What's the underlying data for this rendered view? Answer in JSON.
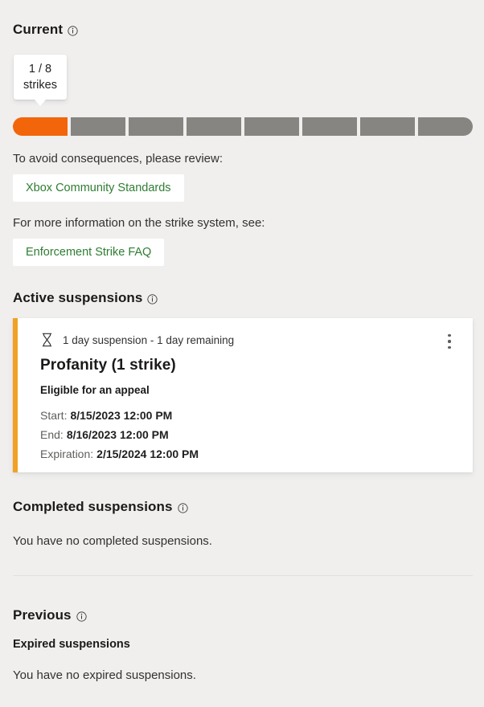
{
  "current": {
    "heading": "Current",
    "info_icon": "info-icon",
    "callout": {
      "count_line": "1 / 8",
      "unit_line": "strikes"
    },
    "meter": {
      "total_segments": 8,
      "filled_segments": 1,
      "filled_color": "#f3650b",
      "empty_color": "#868582"
    },
    "review_prompt": "To avoid consequences, please review:",
    "standards_button": "Xbox Community Standards",
    "info_prompt": "For more information on the strike system, see:",
    "faq_button": "Enforcement Strike FAQ"
  },
  "active": {
    "heading": "Active suspensions",
    "info_icon": "info-icon",
    "card": {
      "accent_color": "#f2a124",
      "status_icon": "hourglass-icon",
      "duration": "1 day suspension - 1 day remaining",
      "title": "Profanity (1 strike)",
      "appeal_status": "Eligible for an appeal",
      "details": [
        {
          "label": "Start:",
          "value": "8/15/2023 12:00 PM"
        },
        {
          "label": "End:",
          "value": "8/16/2023 12:00 PM"
        },
        {
          "label": "Expiration:",
          "value": "2/15/2024 12:00 PM"
        }
      ],
      "menu_icon": "more-options-icon"
    }
  },
  "completed": {
    "heading": "Completed suspensions",
    "info_icon": "info-icon",
    "empty_text": "You have no completed suspensions."
  },
  "previous": {
    "heading": "Previous",
    "info_icon": "info-icon",
    "subheading": "Expired suspensions",
    "empty_text": "You have no expired suspensions."
  },
  "theme": {
    "background": "#f0efee",
    "link_green": "#2e7d32",
    "strike_orange": "#f3650b"
  }
}
